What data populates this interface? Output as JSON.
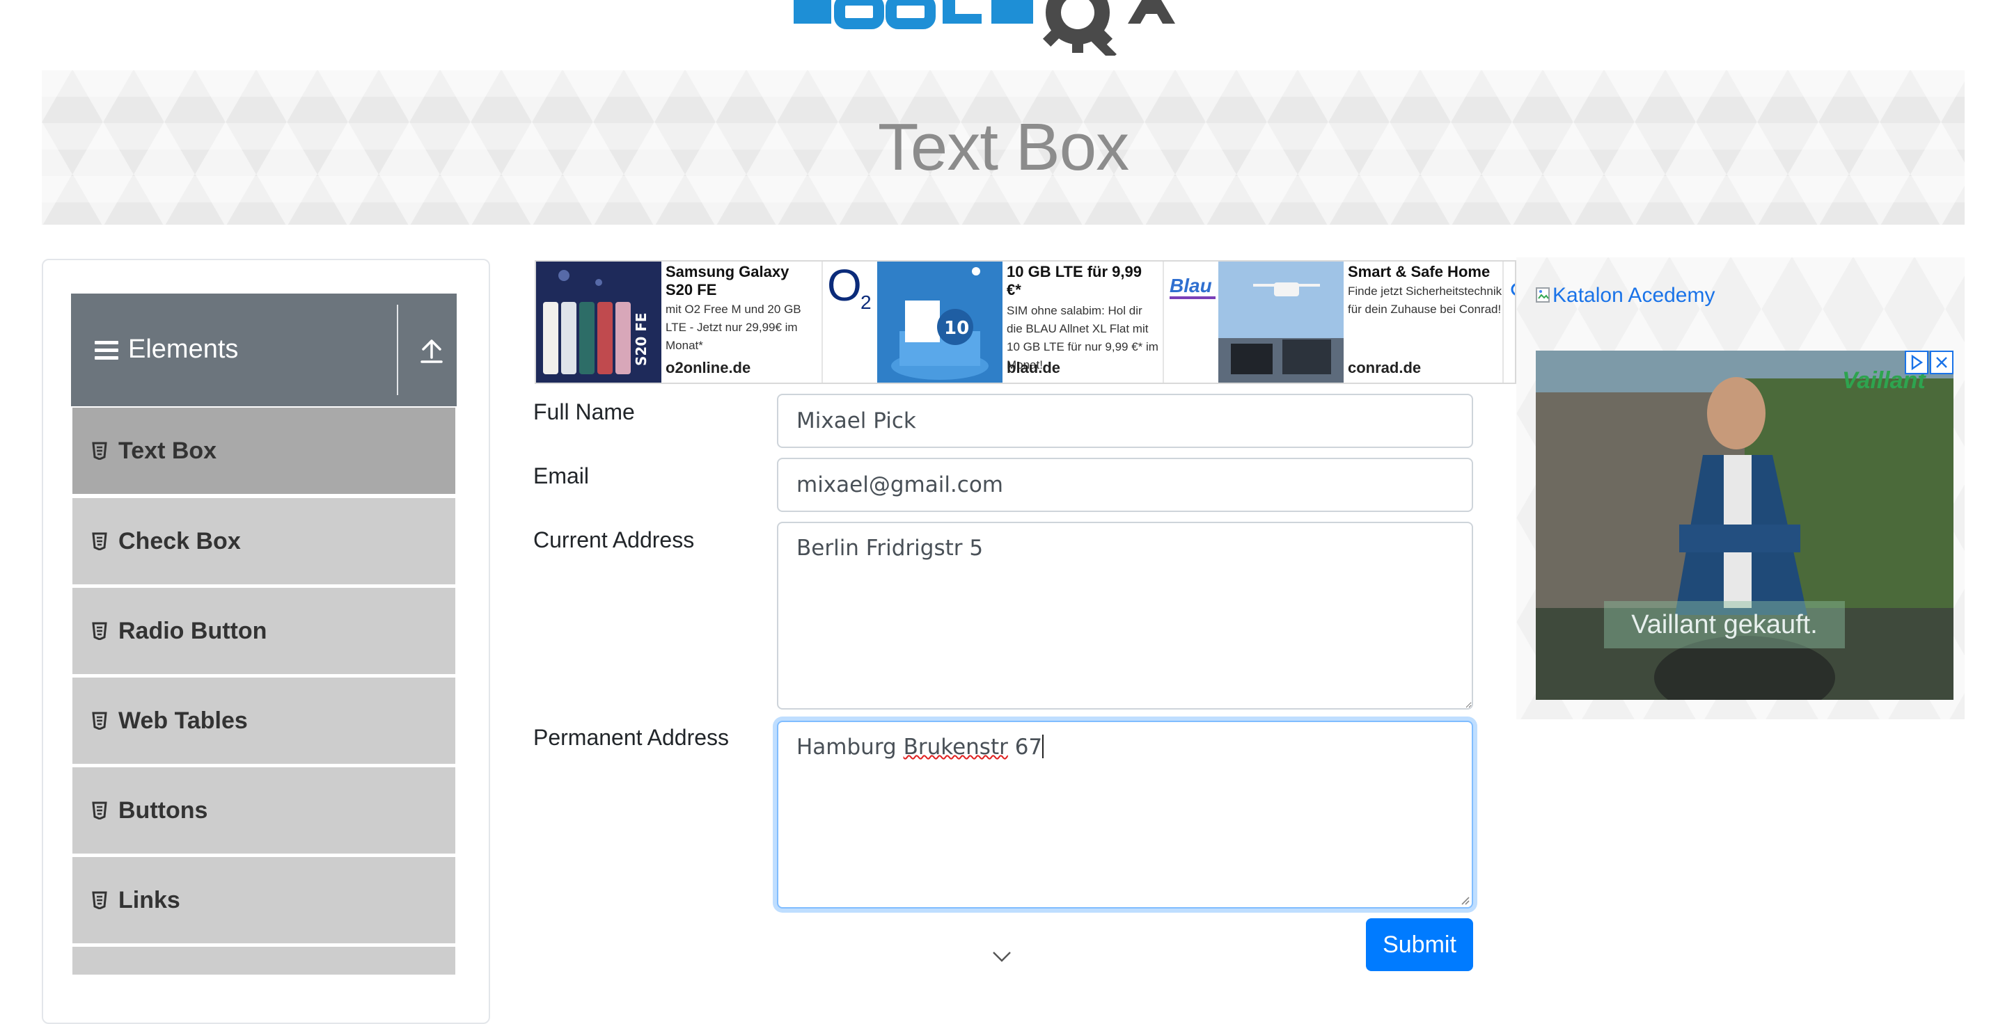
{
  "logo": {
    "alt": "ToolsQA"
  },
  "banner": {
    "title": "Text Box"
  },
  "sidebar": {
    "group_title": "Elements",
    "items": [
      {
        "label": "Text Box",
        "active": true
      },
      {
        "label": "Check Box"
      },
      {
        "label": "Radio Button"
      },
      {
        "label": "Web Tables"
      },
      {
        "label": "Buttons"
      },
      {
        "label": "Links"
      }
    ]
  },
  "ads": [
    {
      "title": "Samsung Galaxy S20 FE",
      "desc": "mit O2 Free M und 20 GB LTE - Jetzt nur 29,99€ im Monat*",
      "domain": "o2online.de",
      "brand": "O2"
    },
    {
      "title": "10 GB LTE für 9,99 €*",
      "desc": "SIM ohne salabim: Hol dir die BLAU Allnet XL Flat mit 10 GB LTE für nur 9,99 €* im Monat!",
      "domain": "blau.de",
      "brand": "Blau"
    },
    {
      "title": "Smart & Safe Home",
      "desc": "Finde jetzt Sicherheitstechnik für dein Zuhause bei Conrad!",
      "domain": "conrad.de",
      "brand": "Conrad"
    }
  ],
  "form": {
    "full_name_label": "Full Name",
    "full_name_value": "Mixael Pick",
    "email_label": "Email",
    "email_value": "mixael@gmail.com",
    "current_address_label": "Current Address",
    "current_address_value": "Berlin Fridrigstr 5",
    "permanent_address_label": "Permanent Address",
    "permanent_address_pre": "Hamburg ",
    "permanent_address_misspelled": "Brukenstr",
    "permanent_address_post": " 67",
    "submit_label": "Submit"
  },
  "right_ad": {
    "link_text": "Katalon Acedemy",
    "brand": "Vaillant",
    "tagline": "Vaillant gekauft."
  },
  "colors": {
    "primary": "#007bff",
    "sidebar_header": "#6c757d",
    "menu_item": "#cdcdcd",
    "menu_item_active": "#a9a9a9",
    "link": "#1a73e8"
  }
}
